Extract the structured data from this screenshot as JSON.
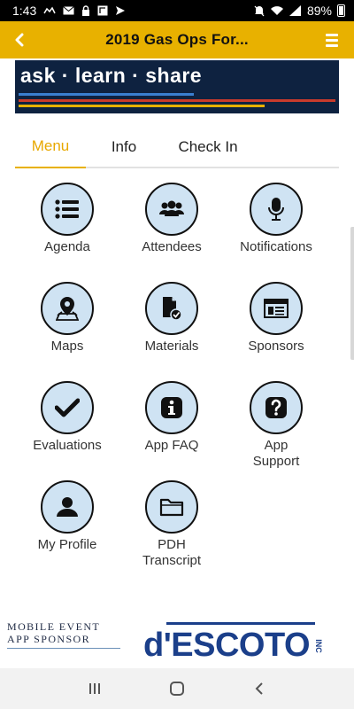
{
  "status_bar": {
    "time": "1:43",
    "battery_percent": "89%",
    "left_icons": [
      "notification-icon",
      "email-icon",
      "lock-icon",
      "cast-icon",
      "send-icon"
    ],
    "right_icons": [
      "mute-icon",
      "wifi-icon",
      "signal-icon",
      "battery-icon"
    ]
  },
  "header": {
    "title": "2019 Gas Ops For...",
    "background_color": "#e8b100",
    "back_icon": "chevron-left-icon",
    "menu_icon": "hamburger-menu-icon"
  },
  "banner": {
    "text": "ask · learn · share",
    "background_color": "#0e2240"
  },
  "tabs": [
    {
      "label": "Menu",
      "active": true
    },
    {
      "label": "Info",
      "active": false
    },
    {
      "label": "Check In",
      "active": false
    }
  ],
  "grid": [
    {
      "label": "Agenda",
      "icon": "list-icon"
    },
    {
      "label": "Attendees",
      "icon": "people-icon"
    },
    {
      "label": "Notifications",
      "icon": "microphone-icon"
    },
    {
      "label": "Maps",
      "icon": "map-pin-icon"
    },
    {
      "label": "Materials",
      "icon": "document-check-icon"
    },
    {
      "label": "Sponsors",
      "icon": "browser-window-icon"
    },
    {
      "label": "Evaluations",
      "icon": "checkmark-icon"
    },
    {
      "label": "App FAQ",
      "icon": "info-icon"
    },
    {
      "label": "App\nSupport",
      "icon": "question-icon"
    },
    {
      "label": "My Profile",
      "icon": "person-icon"
    },
    {
      "label": "PDH\nTranscript",
      "icon": "folder-icon"
    }
  ],
  "sponsor": {
    "line1": "MOBILE EVENT",
    "line2": "APP SPONSOR",
    "logo_text": "d'ESCOTO",
    "logo_suffix": "INC"
  },
  "nav_bar": {
    "buttons": [
      "recent-apps-icon",
      "home-icon",
      "back-icon"
    ]
  }
}
